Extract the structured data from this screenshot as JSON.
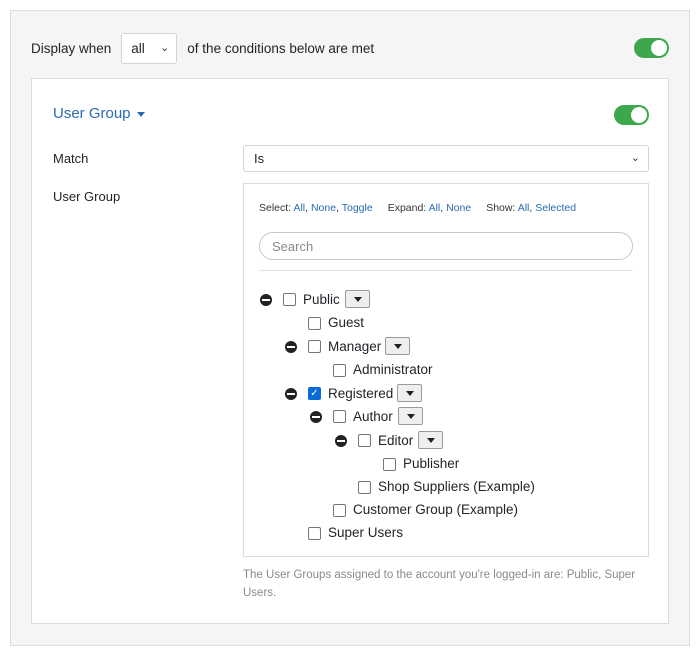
{
  "display": {
    "prefix": "Display when",
    "mode": "all",
    "suffix": "of the conditions below are met",
    "enabled": true
  },
  "condition": {
    "title": "User Group",
    "enabled": true,
    "match_label": "Match",
    "match_value": "Is",
    "group_label": "User Group"
  },
  "toolbar": {
    "select_label": "Select:",
    "select_all": "All",
    "select_none": "None",
    "select_toggle": "Toggle",
    "expand_label": "Expand:",
    "expand_all": "All",
    "expand_none": "None",
    "show_label": "Show:",
    "show_all": "All",
    "show_selected": "Selected"
  },
  "search": {
    "placeholder": "Search"
  },
  "tree": [
    {
      "label": "Public",
      "checked": false
    },
    {
      "label": "Guest",
      "checked": false
    },
    {
      "label": "Manager",
      "checked": false
    },
    {
      "label": "Administrator",
      "checked": false
    },
    {
      "label": "Registered",
      "checked": true
    },
    {
      "label": "Author",
      "checked": false
    },
    {
      "label": "Editor",
      "checked": false
    },
    {
      "label": "Publisher",
      "checked": false
    },
    {
      "label": "Shop Suppliers (Example)",
      "checked": false
    },
    {
      "label": "Customer Group (Example)",
      "checked": false
    },
    {
      "label": "Super Users",
      "checked": false
    }
  ],
  "help_text": "The User Groups assigned to the account you're logged-in are: Public, Super Users."
}
